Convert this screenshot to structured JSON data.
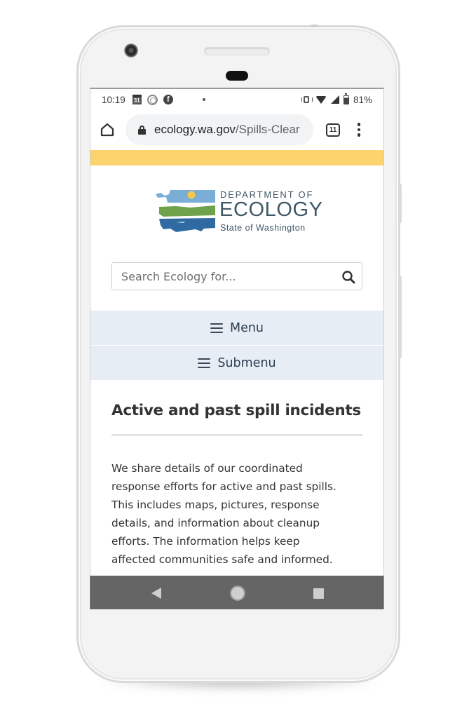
{
  "status_bar": {
    "time": "10:19",
    "calendar_day": "31",
    "notification_icons": [
      "calendar-icon",
      "hotspot-icon",
      "facebook-icon"
    ],
    "system_icons": [
      "vibrate-icon",
      "wifi-icon",
      "cell-signal-icon",
      "battery-icon"
    ],
    "battery_percent": "81%"
  },
  "browser": {
    "url_host": "ecology.wa.gov",
    "url_path": "/Spills-Clear",
    "tab_count": "11"
  },
  "colors": {
    "banner": "#fbd46d",
    "nav_bg": "#e6edf4",
    "logo_text": "#3f5866",
    "logo_sky": "#7aaed6",
    "logo_sun": "#f7c948",
    "logo_land": "#6fa24a",
    "logo_water": "#2f6aa3"
  },
  "logo": {
    "line1": "DEPARTMENT OF",
    "line2": "ECOLOGY",
    "line3": "State of Washington"
  },
  "search": {
    "placeholder": "Search Ecology for..."
  },
  "nav": {
    "menu_label": "Menu",
    "submenu_label": "Submenu"
  },
  "content": {
    "title": "Active and past spill incidents",
    "paragraph_lines": [
      "We share details of our coordinated",
      "response efforts for active and past spills.",
      "This includes maps, pictures, response",
      "details, and information about cleanup",
      "efforts. The information helps keep",
      "affected communities safe and informed."
    ]
  }
}
